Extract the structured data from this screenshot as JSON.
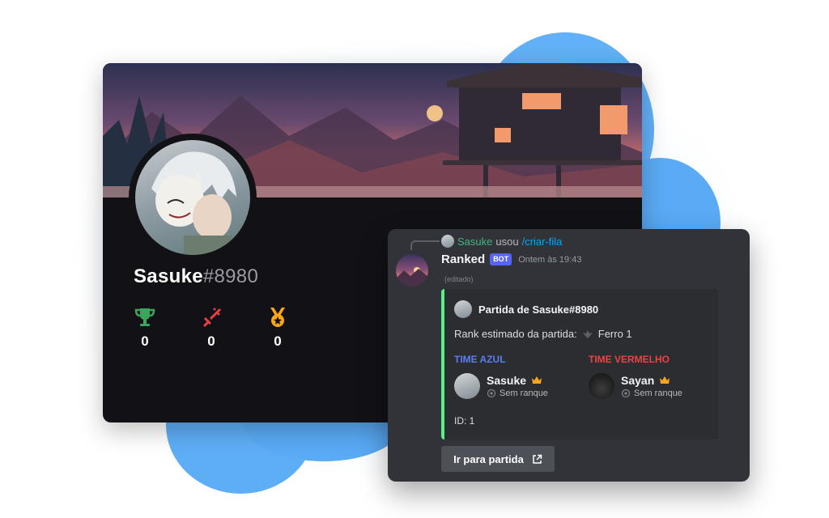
{
  "profile": {
    "username": "Sasuke",
    "discriminator": "#8980",
    "stats": [
      {
        "icon": "trophy-icon",
        "value": "0",
        "color": "#3ba55c"
      },
      {
        "icon": "sword-icon",
        "value": "0",
        "color": "#ed4245"
      },
      {
        "icon": "medal-icon",
        "value": "0",
        "color": "#faa61a"
      }
    ]
  },
  "message": {
    "reply": {
      "user": "Sasuke",
      "used_text": "usou",
      "command": "/criar-fila"
    },
    "author": "Ranked",
    "badge": "BOT",
    "timestamp": "Ontem às 19:43",
    "edited": "(editado)",
    "embed": {
      "accent_color": "#57f287",
      "author": "Partida de Sasuke#8980",
      "rank_label": "Rank estimado da partida:",
      "rank_value": "Ferro 1",
      "teams": [
        {
          "title": "TIME AZUL",
          "color": "#5b7cf5",
          "player": "Sasuke",
          "rank": "Sem ranque"
        },
        {
          "title": "TIME VERMELHO",
          "color": "#ed4245",
          "player": "Sayan",
          "rank": "Sem ranque"
        }
      ],
      "id_text": "ID: 1"
    },
    "button_label": "Ir para partida"
  }
}
